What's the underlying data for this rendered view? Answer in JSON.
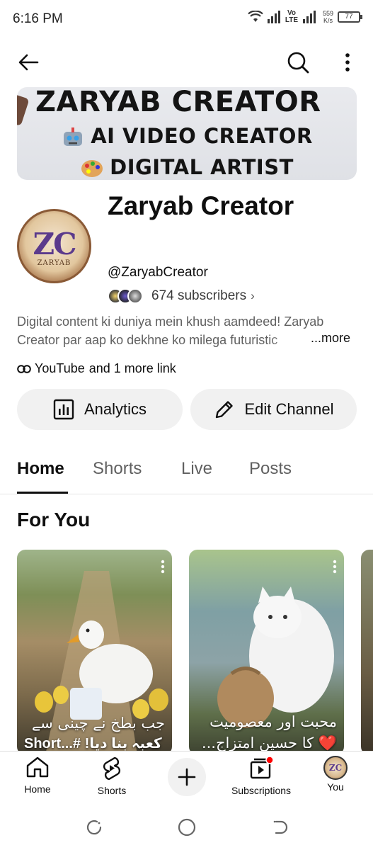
{
  "status_bar": {
    "time": "6:16 PM",
    "network": "Vo LTE",
    "speed_value": "559",
    "speed_unit": "K/s",
    "battery": "77"
  },
  "banner": {
    "line1": "ZARYAB CREATOR",
    "line2": "AI VIDEO CREATOR",
    "line3": "DIGITAL ARTIST"
  },
  "channel": {
    "avatar_initials": "ZC",
    "avatar_text": "ZARYAB",
    "name": "Zaryab Creator",
    "handle": "@ZaryabCreator",
    "subscribers": "674 subscribers",
    "description_line1": "Digital content ki duniya mein khush aamdeed! Zaryab",
    "description_line2": "Creator par aap ko dekhne ko milega futuristic",
    "more_label": "...more",
    "links_text": "YouTube",
    "links_more": "and 1 more link"
  },
  "actions": {
    "analytics": "Analytics",
    "edit_channel": "Edit Channel"
  },
  "tabs": [
    {
      "label": "Home",
      "active": true
    },
    {
      "label": "Shorts"
    },
    {
      "label": "Live"
    },
    {
      "label": "Posts"
    }
  ],
  "section_title": "For You",
  "videos": [
    {
      "caption_urdu": "جب بطخ نے چینی سے",
      "caption_line2": "Short...# !کعبہ بنا دیا"
    },
    {
      "caption_urdu": "محبت اور معصومیت",
      "caption_line2": "...کا حسین امتزاج ❤️"
    }
  ],
  "bottom_nav": {
    "home": "Home",
    "shorts": "Shorts",
    "subscriptions": "Subscriptions",
    "you": "You"
  },
  "colors": {
    "text_primary": "#0f0f0f",
    "text_secondary": "#606060",
    "chip_bg": "#f1f1f1",
    "notification_dot": "#ff0000"
  }
}
